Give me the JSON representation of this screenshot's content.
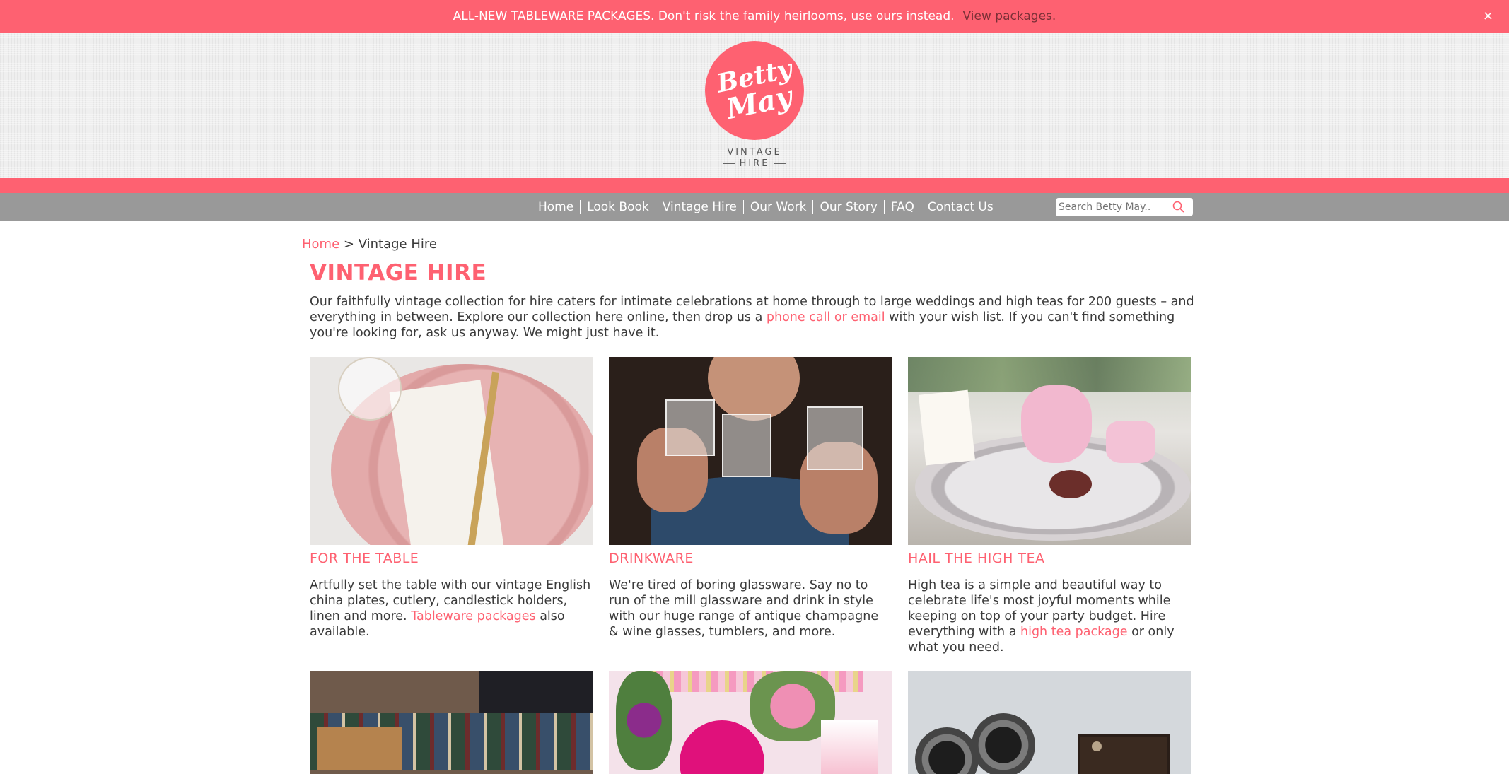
{
  "banner": {
    "message": "ALL-NEW TABLEWARE PACKAGES. Don't risk the family heirlooms, use ours instead.",
    "link": "View packages.",
    "close": "×"
  },
  "logo": {
    "line1": "Betty",
    "line2": "May",
    "sub1": "VINTAGE",
    "sub2": "HIRE"
  },
  "nav": {
    "items": [
      "Home",
      "Look Book",
      "Vintage Hire",
      "Our Work",
      "Our Story",
      "FAQ",
      "Contact Us"
    ],
    "search_placeholder": "Search Betty May.."
  },
  "breadcrumb": {
    "home": "Home",
    "separator": " > ",
    "current": "Vintage Hire"
  },
  "page": {
    "title": "VINTAGE HIRE",
    "intro_1": "Our faithfully vintage collection for hire caters for intimate celebrations at home through to large weddings and high teas for 200 guests – and everything in between. Explore our collection here online, then drop us a ",
    "intro_link": "phone call or email",
    "intro_2": " with your wish list. If you can't find something you're looking for, ask us anyway. We might just have it."
  },
  "cards": [
    {
      "title": "FOR THE TABLE",
      "text_1": "Artfully set the table with our vintage English china plates, cutlery, candlestick holders, linen and more. ",
      "link": "Tableware packages",
      "text_2": " also available."
    },
    {
      "title": "DRINKWARE",
      "text_1": "We're tired of boring glassware. Say no to run of the mill glassware and drink in style with our huge range of antique champagne & wine glasses, tumblers, and more.",
      "link": "",
      "text_2": ""
    },
    {
      "title": "HAIL THE HIGH TEA",
      "text_1": "High tea is a simple and beautiful way to celebrate life's most joyful moments while keeping on top of your party budget. Hire everything with a ",
      "link": "high tea package",
      "text_2": " or only what you need."
    }
  ],
  "colors": {
    "brand_pink": "#fe6171",
    "nav_gray": "#999999",
    "text": "#3a3a3a"
  }
}
